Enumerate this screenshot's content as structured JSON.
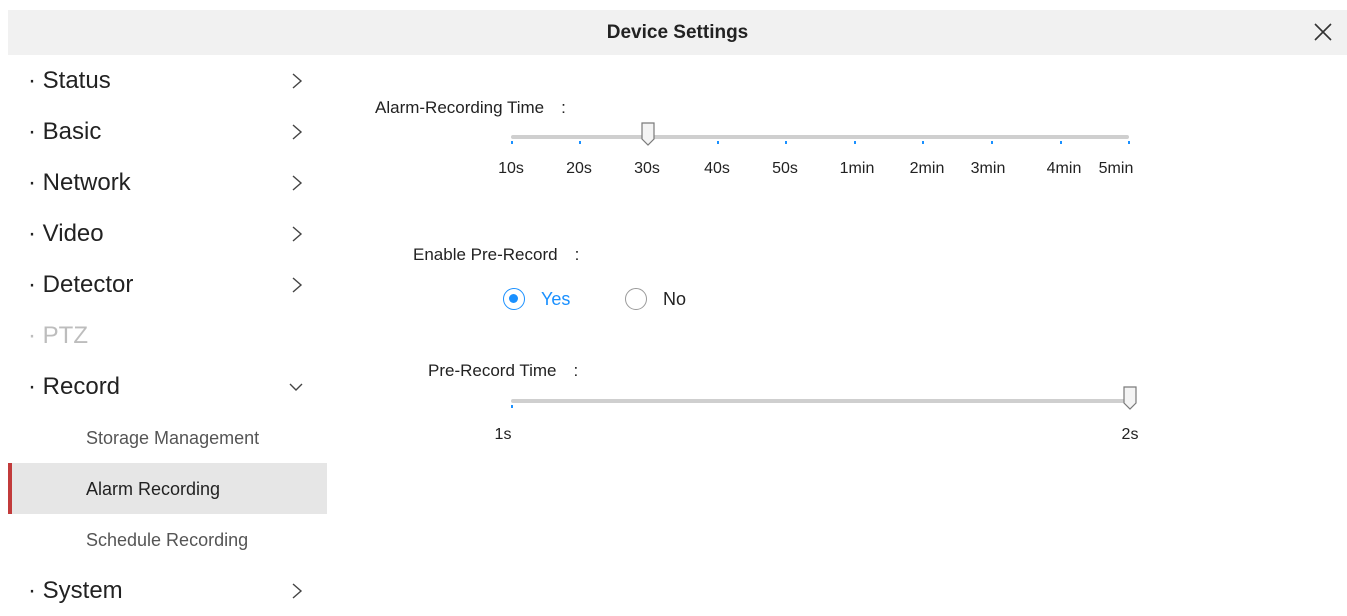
{
  "window": {
    "title": "Device Settings"
  },
  "sidebar": {
    "items": [
      {
        "label": "· Status",
        "chevron": "right",
        "state": "normal"
      },
      {
        "label": "· Basic",
        "chevron": "right",
        "state": "normal"
      },
      {
        "label": "· Network",
        "chevron": "right",
        "state": "normal"
      },
      {
        "label": "· Video",
        "chevron": "right",
        "state": "normal"
      },
      {
        "label": "· Detector",
        "chevron": "right",
        "state": "normal"
      },
      {
        "label": "· PTZ",
        "chevron": "none",
        "state": "disabled"
      },
      {
        "label": "· Record",
        "chevron": "down",
        "state": "expanded"
      },
      {
        "label": "· System",
        "chevron": "right",
        "state": "normal"
      }
    ],
    "record_subitems": [
      {
        "label": "Storage Management",
        "active": false
      },
      {
        "label": "Alarm Recording",
        "active": true
      },
      {
        "label": "Schedule Recording",
        "active": false
      }
    ],
    "accent_color": "#c23b3b"
  },
  "main": {
    "alarm_time": {
      "label": "Alarm-Recording Time　:",
      "ticks": [
        "10s",
        "20s",
        "30s",
        "40s",
        "50s",
        "1min",
        "2min",
        "3min",
        "4min",
        "5min"
      ],
      "selected": "30s"
    },
    "pre_record_enable": {
      "label": "Enable Pre-Record　:",
      "options": [
        {
          "label": "Yes",
          "checked": true
        },
        {
          "label": "No",
          "checked": false
        }
      ]
    },
    "pre_record_time": {
      "label": "Pre-Record Time　:",
      "ticks": [
        "1s",
        "2s"
      ],
      "selected": "2s"
    },
    "accent_color": "#1a90ff"
  },
  "icons": {
    "close": "close-icon",
    "chevron_right": "chevron-right-icon",
    "chevron_down": "chevron-down-icon",
    "slider_thumb": "slider-thumb-icon"
  }
}
